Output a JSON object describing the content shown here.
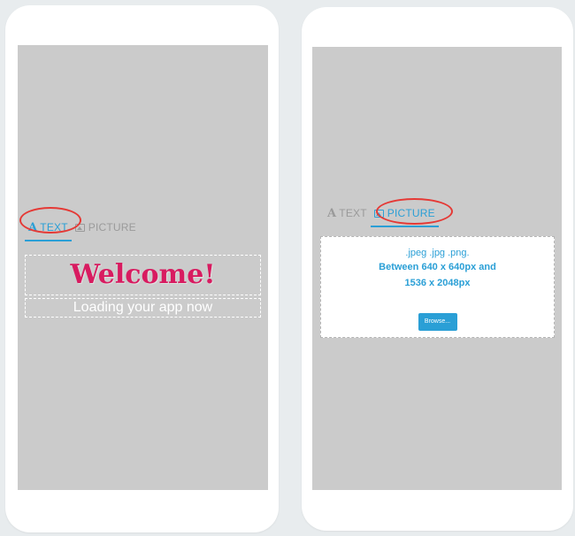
{
  "left_phone": {
    "tabs": {
      "text": {
        "icon": "text-icon",
        "glyph": "A",
        "label": "TEXT",
        "active": true
      },
      "picture": {
        "icon": "picture-icon",
        "label": "PICTURE",
        "active": false
      }
    },
    "welcome_text": "Welcome!",
    "loading_text": "Loading your app now"
  },
  "right_phone": {
    "tabs": {
      "text": {
        "icon": "text-icon",
        "glyph": "A",
        "label": "TEXT",
        "active": false
      },
      "picture": {
        "icon": "picture-icon",
        "label": "PICTURE",
        "active": true
      }
    },
    "upload": {
      "formats": ".jpeg .jpg .png.",
      "dimensions_line1": "Between 640 x 640px and",
      "dimensions_line2": "1536 x 2048px",
      "browse_label": "Browse..."
    }
  },
  "colors": {
    "accent": "#2a9fd6",
    "welcome": "#d81b60",
    "callout": "#e53935",
    "screen": "#cbcbcb"
  }
}
